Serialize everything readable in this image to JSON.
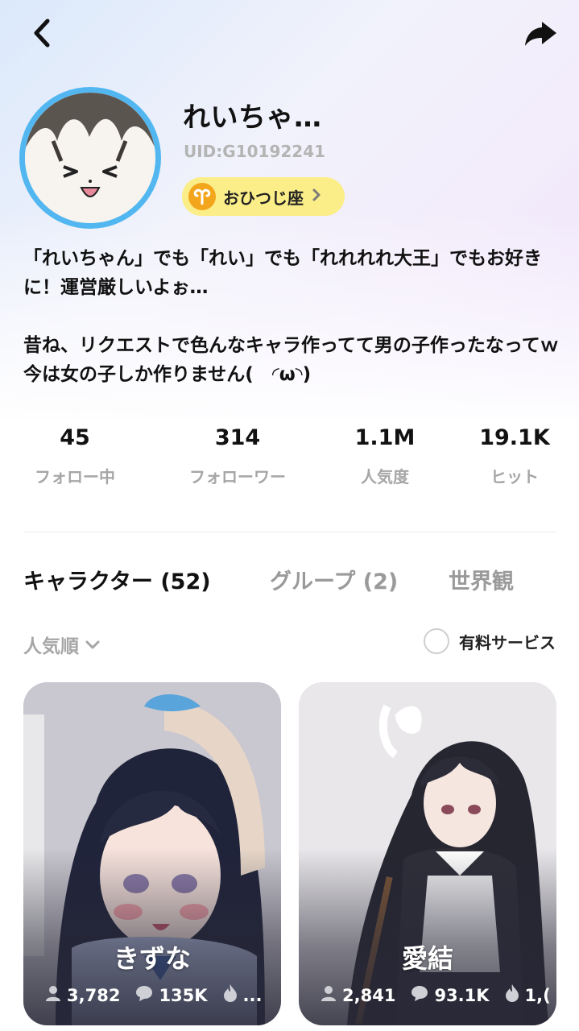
{
  "profile": {
    "name": "れいちゃ…",
    "uid": "UID:G10192241",
    "zodiac": "おひつじ座",
    "bio": "「れいちゃん」でも「れい」でも「れれれれ大王」でもお好きに！運営厳しいよぉ…\n\n昔ね、リクエストで色んなキャラ作ってて男の子作ったなってｗ今は女の子しか作りません(　◜ω◝)"
  },
  "stats": [
    {
      "value": "45",
      "label": "フォロー中"
    },
    {
      "value": "314",
      "label": "フォローワー"
    },
    {
      "value": "1.1M",
      "label": "人気度"
    },
    {
      "value": "19.1K",
      "label": "ヒット"
    }
  ],
  "tabs": [
    {
      "label": "キャラクター (52)",
      "active": true
    },
    {
      "label": "グループ (2)",
      "active": false
    },
    {
      "label": "世界観",
      "active": false
    }
  ],
  "sort": {
    "label": "人気順"
  },
  "filter": {
    "paid_label": "有料サービス"
  },
  "cards": [
    {
      "name": "きずな",
      "users": "3,782",
      "chats": "135K",
      "likes": "..."
    },
    {
      "name": "愛結",
      "users": "2,841",
      "chats": "93.1K",
      "likes": "1,("
    }
  ],
  "colors": {
    "avatar_ring": "#52b7f0",
    "zodiac_bg": "#fbee88",
    "zodiac_icon": "#f3a51b"
  },
  "icons": [
    "back-arrow-icon",
    "share-icon",
    "aries-icon",
    "chevron-right-icon",
    "chevron-down-icon",
    "user-icon",
    "chat-bubble-icon",
    "flame-icon"
  ]
}
